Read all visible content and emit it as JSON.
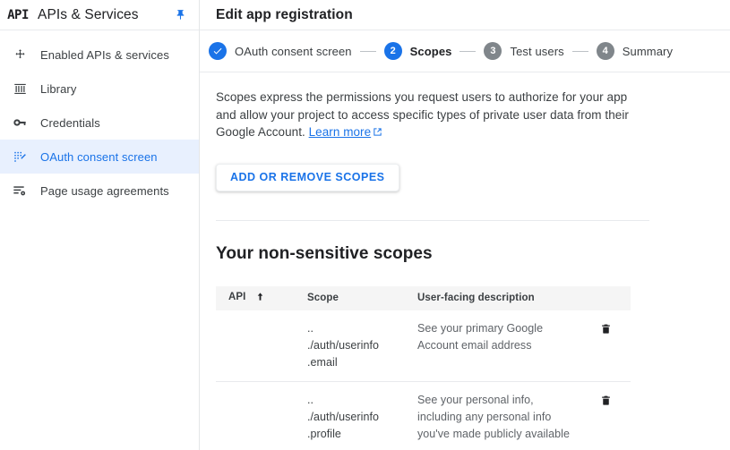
{
  "sidebar": {
    "logo_text": "API",
    "title": "APIs & Services",
    "pin_icon": "pin-icon",
    "items": [
      {
        "label": "Enabled APIs & services",
        "icon": "dashboard-icon",
        "active": false
      },
      {
        "label": "Library",
        "icon": "library-icon",
        "active": false
      },
      {
        "label": "Credentials",
        "icon": "key-icon",
        "active": false
      },
      {
        "label": "OAuth consent screen",
        "icon": "oauth-consent-icon",
        "active": true
      },
      {
        "label": "Page usage agreements",
        "icon": "page-usage-icon",
        "active": false
      }
    ]
  },
  "main": {
    "title": "Edit app registration",
    "stepper": [
      {
        "marker": "✓",
        "label": "OAuth consent screen",
        "state": "done"
      },
      {
        "marker": "2",
        "label": "Scopes",
        "state": "current"
      },
      {
        "marker": "3",
        "label": "Test users",
        "state": "pending"
      },
      {
        "marker": "4",
        "label": "Summary",
        "state": "pending"
      }
    ],
    "description": {
      "text": "Scopes express the permissions you request users to authorize for your app and allow your project to access specific types of private user data from their Google Account. ",
      "link_label": "Learn more",
      "link_icon": "external-link-icon"
    },
    "add_remove_button": "ADD OR REMOVE SCOPES",
    "section_title": "Your non-sensitive scopes",
    "table": {
      "columns": [
        "API",
        "Scope",
        "User-facing description",
        ""
      ],
      "sort_column": "API",
      "sort_icon": "sort-ascending-arrow-icon",
      "rows": [
        {
          "api": "",
          "scope": "..\n./auth/userinfo\n.email",
          "description": "See your primary Google Account email address",
          "delete_icon": "trash-icon"
        },
        {
          "api": "",
          "scope": "..\n./auth/userinfo\n.profile",
          "description": "See your personal info, including any personal info you've made publicly available",
          "delete_icon": "trash-icon"
        }
      ]
    }
  },
  "colors": {
    "accent": "#1a73e8",
    "active_bg": "#e8f0fe",
    "pending_step": "#80868b",
    "text_primary": "#202124",
    "text_secondary": "#5f6368",
    "border": "#e8eaed",
    "table_header_bg": "#f5f5f5"
  }
}
